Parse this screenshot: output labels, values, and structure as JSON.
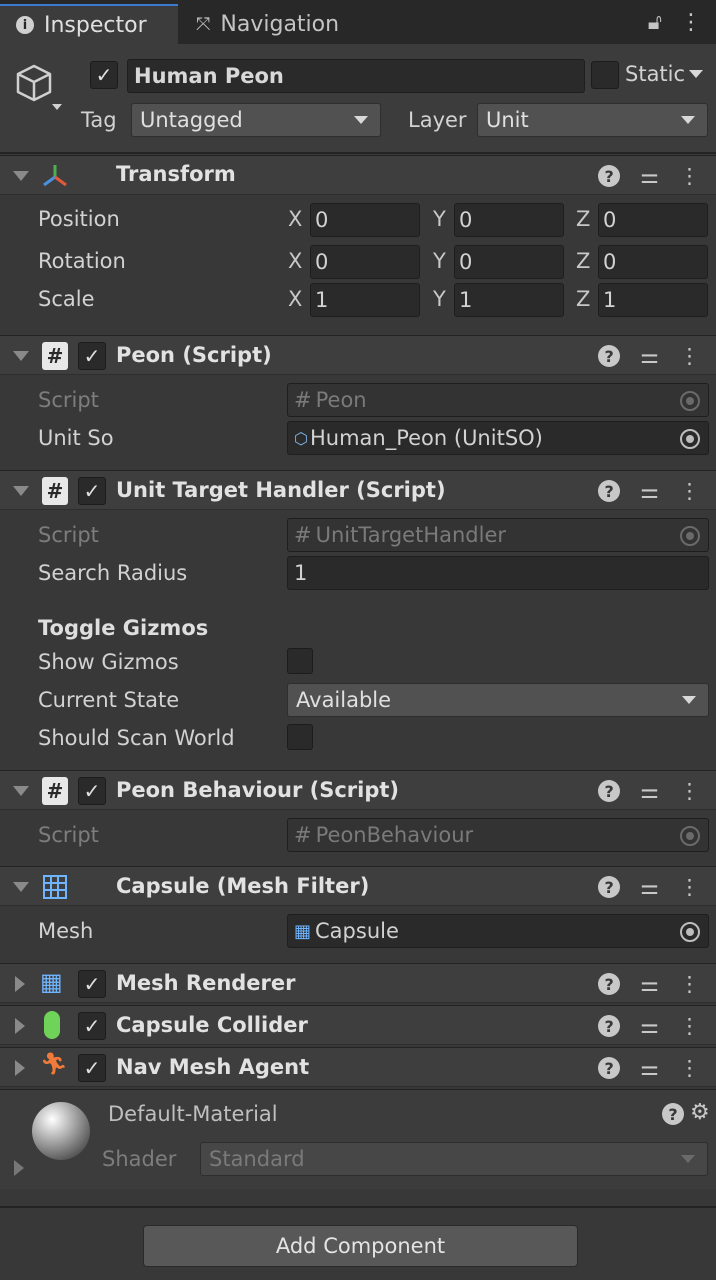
{
  "tabs": {
    "inspector": "Inspector",
    "navigation": "Navigation"
  },
  "object": {
    "name": "Human Peon",
    "static_label": "Static",
    "tag_label": "Tag",
    "tag_value": "Untagged",
    "layer_label": "Layer",
    "layer_value": "Unit"
  },
  "transform": {
    "title": "Transform",
    "position_label": "Position",
    "rotation_label": "Rotation",
    "scale_label": "Scale",
    "x": "X",
    "y": "Y",
    "z": "Z",
    "position": [
      "0",
      "0",
      "0"
    ],
    "rotation": [
      "0",
      "0",
      "0"
    ],
    "scale": [
      "1",
      "1",
      "1"
    ]
  },
  "peon": {
    "title": "Peon (Script)",
    "script_label": "Script",
    "script_value": "Peon",
    "unitso_label": "Unit So",
    "unitso_value": "Human_Peon (UnitSO)"
  },
  "unit_target": {
    "title": "Unit Target Handler (Script)",
    "script_label": "Script",
    "script_value": "UnitTargetHandler",
    "search_radius_label": "Search Radius",
    "search_radius_value": "1",
    "toggle_gizmos_label": "Toggle Gizmos",
    "show_gizmos_label": "Show Gizmos",
    "current_state_label": "Current State",
    "current_state_value": "Available",
    "should_scan_label": "Should Scan World"
  },
  "peon_behaviour": {
    "title": "Peon Behaviour (Script)",
    "script_label": "Script",
    "script_value": "PeonBehaviour"
  },
  "mesh_filter": {
    "title": "Capsule (Mesh Filter)",
    "mesh_label": "Mesh",
    "mesh_value": "Capsule"
  },
  "collapsed": {
    "mesh_renderer": "Mesh Renderer",
    "capsule_collider": "Capsule Collider",
    "nav_mesh_agent": "Nav Mesh Agent"
  },
  "material": {
    "name": "Default-Material",
    "shader_label": "Shader",
    "shader_value": "Standard"
  },
  "add_component": "Add Component"
}
